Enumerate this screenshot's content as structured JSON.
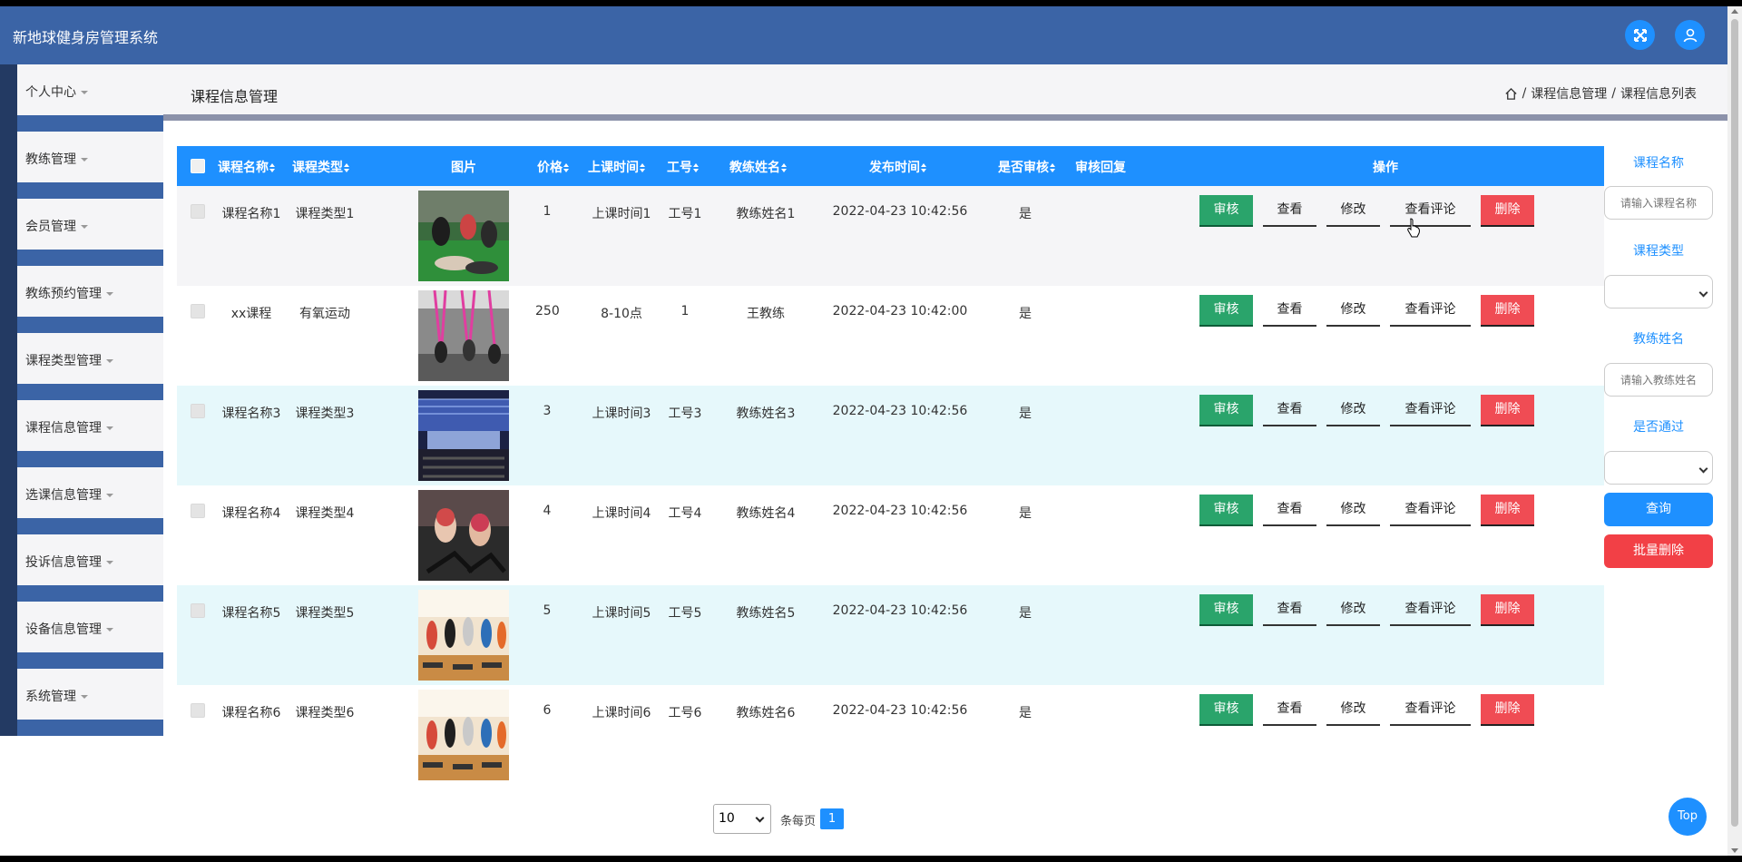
{
  "app": {
    "title": "新地球健身房管理系统"
  },
  "colors": {
    "topbar": "#3b64a6",
    "table_header": "#1e90ff",
    "audit": "#2aa46b",
    "delete": "#f04c54",
    "row_highlight": "#e6f8fb",
    "row_alt": "#f5f5f7"
  },
  "icons": {
    "fullscreen": "fullscreen-icon",
    "user": "user-icon",
    "home": "home-icon"
  },
  "sidebar": {
    "items": [
      {
        "label": "个人中心"
      },
      {
        "label": "教练管理"
      },
      {
        "label": "会员管理"
      },
      {
        "label": "教练预约管理"
      },
      {
        "label": "课程类型管理"
      },
      {
        "label": "课程信息管理"
      },
      {
        "label": "选课信息管理"
      },
      {
        "label": "投诉信息管理"
      },
      {
        "label": "设备信息管理"
      },
      {
        "label": "系统管理"
      }
    ]
  },
  "header": {
    "title": "课程信息管理",
    "breadcrumb": [
      "课程信息管理",
      "课程信息列表"
    ],
    "separator": "/"
  },
  "table": {
    "columns": [
      "课程名称",
      "课程类型",
      "图片",
      "价格",
      "上课时间",
      "工号",
      "教练姓名",
      "发布时间",
      "是否审核",
      "审核回复",
      "操作"
    ],
    "actions": {
      "audit": "审核",
      "view": "查看",
      "edit": "修改",
      "comments": "查看评论",
      "delete": "删除"
    },
    "rows": [
      {
        "name": "课程名称1",
        "type": "课程类型1",
        "image": "group-stretching-photo",
        "price": "1",
        "time": "上课时间1",
        "job_no": "工号1",
        "coach": "教练姓名1",
        "published": "2022-04-23 10:42:56",
        "approved": "是",
        "reply": ""
      },
      {
        "name": "xx课程",
        "type": "有氧运动",
        "image": "aerial-yoga-photo",
        "price": "250",
        "time": "8-10点",
        "job_no": "1",
        "coach": "王教练",
        "published": "2022-04-23 10:42:00",
        "approved": "是",
        "reply": ""
      },
      {
        "name": "课程名称3",
        "type": "课程类型3",
        "image": "gym-hall-photo",
        "price": "3",
        "time": "上课时间3",
        "job_no": "工号3",
        "coach": "教练姓名3",
        "published": "2022-04-23 10:42:56",
        "approved": "是",
        "reply": ""
      },
      {
        "name": "课程名称4",
        "type": "课程类型4",
        "image": "cycling-class-photo",
        "price": "4",
        "time": "上课时间4",
        "job_no": "工号4",
        "coach": "教练姓名4",
        "published": "2022-04-23 10:42:56",
        "approved": "是",
        "reply": ""
      },
      {
        "name": "课程名称5",
        "type": "课程类型5",
        "image": "step-aerobics-photo",
        "price": "5",
        "time": "上课时间5",
        "job_no": "工号5",
        "coach": "教练姓名5",
        "published": "2022-04-23 10:42:56",
        "approved": "是",
        "reply": ""
      },
      {
        "name": "课程名称6",
        "type": "课程类型6",
        "image": "step-aerobics-photo",
        "price": "6",
        "time": "上课时间6",
        "job_no": "工号6",
        "coach": "教练姓名6",
        "published": "2022-04-23 10:42:56",
        "approved": "是",
        "reply": ""
      }
    ]
  },
  "search": {
    "course_name_label": "课程名称",
    "course_name_placeholder": "请输入课程名称",
    "course_type_label": "课程类型",
    "coach_name_label": "教练姓名",
    "coach_name_placeholder": "请输入教练姓名",
    "approved_label": "是否通过",
    "query_button": "查询",
    "batch_delete_button": "批量删除"
  },
  "pagination": {
    "page_size": "10",
    "per_page_label": "条每页",
    "current_page": "1"
  },
  "back_to_top": "Top"
}
